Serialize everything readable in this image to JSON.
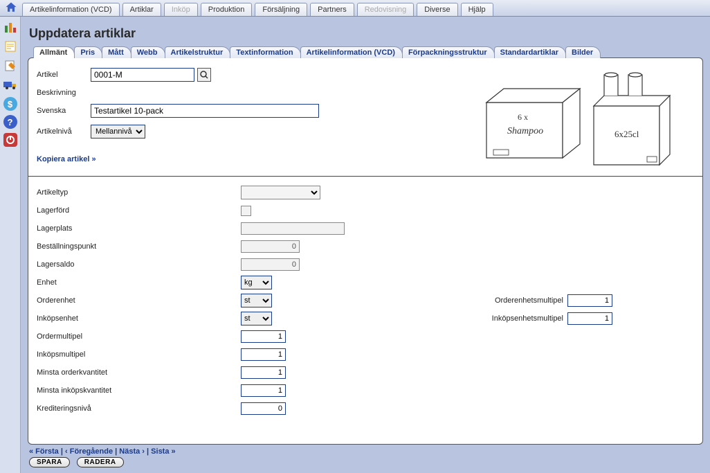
{
  "topmenu": [
    {
      "label": "Artikelinformation (VCD)",
      "disabled": false
    },
    {
      "label": "Artiklar",
      "disabled": false
    },
    {
      "label": "Inköp",
      "disabled": true
    },
    {
      "label": "Produktion",
      "disabled": false
    },
    {
      "label": "Försäljning",
      "disabled": false
    },
    {
      "label": "Partners",
      "disabled": false
    },
    {
      "label": "Redovisning",
      "disabled": true
    },
    {
      "label": "Diverse",
      "disabled": false
    },
    {
      "label": "Hjälp",
      "disabled": false
    }
  ],
  "page_title": "Uppdatera artiklar",
  "formtabs": [
    {
      "label": "Allmänt",
      "active": true
    },
    {
      "label": "Pris"
    },
    {
      "label": "Mått"
    },
    {
      "label": "Webb"
    },
    {
      "label": "Artikelstruktur"
    },
    {
      "label": "Textinformation"
    },
    {
      "label": "Artikelinformation (VCD)"
    },
    {
      "label": "Förpackningsstruktur"
    },
    {
      "label": "Standardartiklar"
    },
    {
      "label": "Bilder"
    }
  ],
  "upper": {
    "artikel_label": "Artikel",
    "artikel_value": "0001-M",
    "beskrivning_label": "Beskrivning",
    "svenska_label": "Svenska",
    "svenska_value": "Testartikel 10-pack",
    "niva_label": "Artikelnivå",
    "niva_value": "Mellannivå",
    "copy_link": "Kopiera artikel »",
    "illus_box": "6 x Shampoo",
    "illus_bottles": "6x25cl"
  },
  "fields": {
    "artikeltyp": "Artikeltyp",
    "lagerford": "Lagerförd",
    "lagerplats": "Lagerplats",
    "bestallningspunkt": "Beställningspunkt",
    "bestallningspunkt_val": "0",
    "lagersaldo": "Lagersaldo",
    "lagersaldo_val": "0",
    "enhet": "Enhet",
    "enhet_val": "kg",
    "orderenhet": "Orderenhet",
    "orderenhet_val": "st",
    "orderenhetsmultipel": "Orderenhetsmultipel",
    "orderenhetsmultipel_val": "1",
    "inkopsenhet": "Inköpsenhet",
    "inkopsenhet_val": "st",
    "inkopsenhetsmultipel": "Inköpsenhetsmultipel",
    "inkopsenhetsmultipel_val": "1",
    "ordermultipel": "Ordermultipel",
    "ordermultipel_val": "1",
    "inkopsmultipel": "Inköpsmultipel",
    "inkopsmultipel_val": "1",
    "minorder": "Minsta orderkvantitet",
    "minorder_val": "1",
    "mininkop": "Minsta inköpskvantitet",
    "mininkop_val": "1",
    "kreditering": "Krediteringsnivå",
    "kreditering_val": "0"
  },
  "nav": {
    "first": "« Första",
    "prev": "‹ Föregående",
    "next": "Nästa ›",
    "last": "Sista »",
    "save": "SPARA",
    "delete": "RADERA"
  }
}
